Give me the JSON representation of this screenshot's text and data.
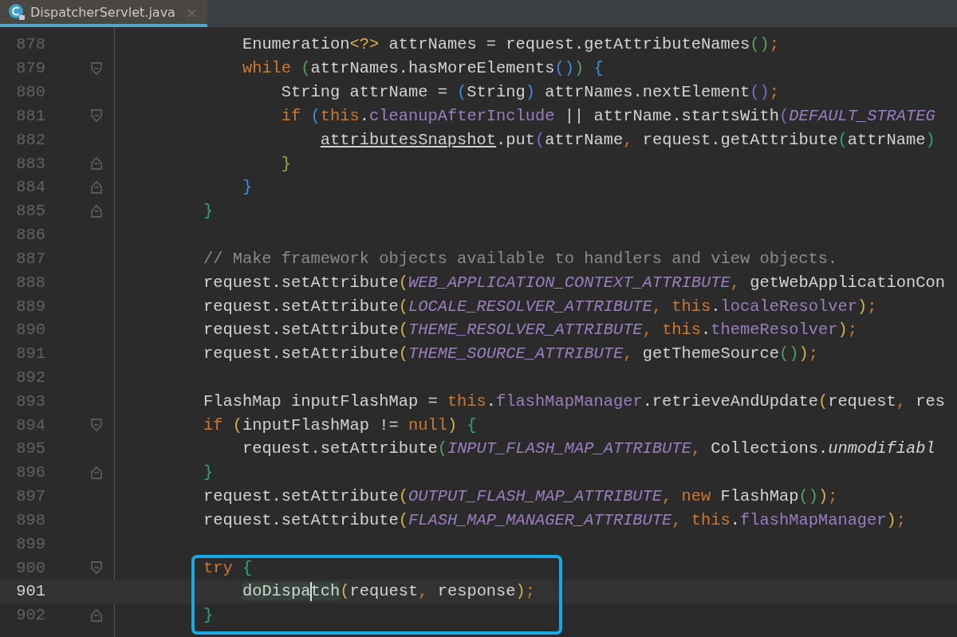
{
  "tabs": [
    {
      "label": "DispatcherServlet.java",
      "close": "×",
      "selected": true
    }
  ],
  "lines": [
    {
      "number": "878",
      "current": false,
      "boxed": false,
      "tokens": [
        {
          "kind": "plain",
          "t": "        Enumeration"
        },
        {
          "kind": "paren",
          "t": "<?>",
          "color": "#d8b449"
        },
        {
          "kind": "plain",
          "t": " attrNames = request.getAttributeNames"
        },
        {
          "kind": "paren",
          "t": "()",
          "color": "#4fa65a"
        },
        {
          "kind": "punct",
          "t": ";"
        }
      ]
    },
    {
      "number": "879",
      "current": false,
      "boxed": false,
      "fold_start": true,
      "fold_end": false,
      "tokens": [
        {
          "kind": "keyword",
          "t": "        while"
        },
        {
          "kind": "paren",
          "t": " (",
          "color": "#4fa65a"
        },
        {
          "kind": "plain",
          "t": "attrNames.hasMoreElements"
        },
        {
          "kind": "paren",
          "t": "()",
          "color": "#3f8fe0"
        },
        {
          "kind": "paren",
          "t": ")",
          "color": "#4fa65a"
        },
        {
          "kind": "paren",
          "t": " {",
          "color": "#3f8fe0"
        }
      ]
    },
    {
      "number": "880",
      "current": false,
      "boxed": false,
      "tokens": [
        {
          "kind": "plain",
          "t": "            String attrName = "
        },
        {
          "kind": "paren",
          "t": "(",
          "color": "#3f8fe0"
        },
        {
          "kind": "plain",
          "t": "String"
        },
        {
          "kind": "paren",
          "t": ")",
          "color": "#3f8fe0"
        },
        {
          "kind": "plain",
          "t": " attrNames.nextElement"
        },
        {
          "kind": "paren",
          "t": "()",
          "color": "#7f6ad0"
        },
        {
          "kind": "punct",
          "t": ";"
        }
      ]
    },
    {
      "number": "881",
      "current": false,
      "boxed": false,
      "fold_start": true,
      "fold_end": false,
      "tokens": [
        {
          "kind": "keyword",
          "t": "            if"
        },
        {
          "kind": "paren",
          "t": " (",
          "color": "#3f8fe0"
        },
        {
          "kind": "keyword",
          "t": "this"
        },
        {
          "kind": "plain",
          "t": "."
        },
        {
          "kind": "field",
          "t": "cleanupAfterInclude"
        },
        {
          "kind": "plain",
          "t": " || attrName.startsWith"
        },
        {
          "kind": "paren",
          "t": "(",
          "color": "#7f6ad0"
        },
        {
          "kind": "constant",
          "t": "DEFAULT_STRATEG"
        }
      ]
    },
    {
      "number": "882",
      "current": false,
      "boxed": false,
      "tokens": [
        {
          "kind": "underlined",
          "t": "                attributesSnapshot"
        },
        {
          "kind": "plain",
          "t": ".put"
        },
        {
          "kind": "paren",
          "t": "(",
          "color": "#7f6ad0"
        },
        {
          "kind": "plain",
          "t": "attrName"
        },
        {
          "kind": "punct",
          "t": ","
        },
        {
          "kind": "plain",
          "t": " request.getAttribute"
        },
        {
          "kind": "paren",
          "t": "(",
          "color": "#2fa38a"
        },
        {
          "kind": "plain",
          "t": "attrName"
        },
        {
          "kind": "paren",
          "t": ")",
          "color": "#2fa38a"
        }
      ]
    },
    {
      "number": "883",
      "current": false,
      "boxed": false,
      "fold_start": false,
      "fold_end": true,
      "tokens": [
        {
          "kind": "paren",
          "t": "            }",
          "color": "#8fb03a"
        }
      ]
    },
    {
      "number": "884",
      "current": false,
      "boxed": false,
      "fold_start": false,
      "fold_end": true,
      "tokens": [
        {
          "kind": "paren",
          "t": "        }",
          "color": "#3f8fe0"
        }
      ]
    },
    {
      "number": "885",
      "current": false,
      "boxed": false,
      "fold_start": false,
      "fold_end": true,
      "tokens": [
        {
          "kind": "paren",
          "t": "    }",
          "color": "#2fa38a"
        }
      ]
    },
    {
      "number": "886",
      "current": false,
      "boxed": false
    },
    {
      "number": "887",
      "current": false,
      "boxed": false,
      "tokens": [
        {
          "kind": "comment",
          "t": "    // Make framework objects available to handlers and view objects."
        }
      ]
    },
    {
      "number": "888",
      "current": false,
      "boxed": false,
      "tokens": [
        {
          "kind": "plain",
          "t": "    request.setAttribute"
        },
        {
          "kind": "paren",
          "t": "(",
          "color": "#d8b449"
        },
        {
          "kind": "constant",
          "t": "WEB_APPLICATION_CONTEXT_ATTRIBUTE"
        },
        {
          "kind": "punct",
          "t": ","
        },
        {
          "kind": "plain",
          "t": " getWebApplicationCon"
        }
      ]
    },
    {
      "number": "889",
      "current": false,
      "boxed": false,
      "tokens": [
        {
          "kind": "plain",
          "t": "    request.setAttribute"
        },
        {
          "kind": "paren",
          "t": "(",
          "color": "#d8b449"
        },
        {
          "kind": "constant",
          "t": "LOCALE_RESOLVER_ATTRIBUTE"
        },
        {
          "kind": "punct",
          "t": ","
        },
        {
          "kind": "keyword",
          "t": " this"
        },
        {
          "kind": "plain",
          "t": "."
        },
        {
          "kind": "field",
          "t": "localeResolver"
        },
        {
          "kind": "paren",
          "t": ")",
          "color": "#d8b449"
        },
        {
          "kind": "punct",
          "t": ";"
        }
      ]
    },
    {
      "number": "890",
      "current": false,
      "boxed": false,
      "tokens": [
        {
          "kind": "plain",
          "t": "    request.setAttribute"
        },
        {
          "kind": "paren",
          "t": "(",
          "color": "#d8b449"
        },
        {
          "kind": "constant",
          "t": "THEME_RESOLVER_ATTRIBUTE"
        },
        {
          "kind": "punct",
          "t": ","
        },
        {
          "kind": "keyword",
          "t": " this"
        },
        {
          "kind": "plain",
          "t": "."
        },
        {
          "kind": "field",
          "t": "themeResolver"
        },
        {
          "kind": "paren",
          "t": ")",
          "color": "#d8b449"
        },
        {
          "kind": "punct",
          "t": ";"
        }
      ]
    },
    {
      "number": "891",
      "current": false,
      "boxed": false,
      "tokens": [
        {
          "kind": "plain",
          "t": "    request.setAttribute"
        },
        {
          "kind": "paren",
          "t": "(",
          "color": "#d8b449"
        },
        {
          "kind": "constant",
          "t": "THEME_SOURCE_ATTRIBUTE"
        },
        {
          "kind": "punct",
          "t": ","
        },
        {
          "kind": "plain",
          "t": " getThemeSource"
        },
        {
          "kind": "paren",
          "t": "()",
          "color": "#4fa65a"
        },
        {
          "kind": "paren",
          "t": ")",
          "color": "#d8b449"
        },
        {
          "kind": "punct",
          "t": ";"
        }
      ]
    },
    {
      "number": "892",
      "current": false,
      "boxed": false
    },
    {
      "number": "893",
      "current": false,
      "boxed": false,
      "tokens": [
        {
          "kind": "plain",
          "t": "    FlashMap inputFlashMap = "
        },
        {
          "kind": "keyword",
          "t": "this"
        },
        {
          "kind": "plain",
          "t": "."
        },
        {
          "kind": "field",
          "t": "flashMapManager"
        },
        {
          "kind": "plain",
          "t": ".retrieveAndUpdate"
        },
        {
          "kind": "paren",
          "t": "(",
          "color": "#d8b449"
        },
        {
          "kind": "plain",
          "t": "request"
        },
        {
          "kind": "punct",
          "t": ","
        },
        {
          "kind": "plain",
          "t": " res"
        }
      ]
    },
    {
      "number": "894",
      "current": false,
      "boxed": false,
      "fold_start": true,
      "fold_end": false,
      "tokens": [
        {
          "kind": "keyword",
          "t": "    if"
        },
        {
          "kind": "paren",
          "t": " (",
          "color": "#d8b449"
        },
        {
          "kind": "plain",
          "t": "inputFlashMap != "
        },
        {
          "kind": "keyword",
          "t": "null"
        },
        {
          "kind": "paren",
          "t": ")",
          "color": "#d8b449"
        },
        {
          "kind": "paren",
          "t": " {",
          "color": "#2fa38a"
        }
      ]
    },
    {
      "number": "895",
      "current": false,
      "boxed": false,
      "tokens": [
        {
          "kind": "plain",
          "t": "        request.setAttribute"
        },
        {
          "kind": "paren",
          "t": "(",
          "color": "#4fa65a"
        },
        {
          "kind": "constant",
          "t": "INPUT_FLASH_MAP_ATTRIBUTE"
        },
        {
          "kind": "punct",
          "t": ","
        },
        {
          "kind": "plain",
          "t": " Collections."
        },
        {
          "kind": "static",
          "t": "unmodifiabl"
        }
      ]
    },
    {
      "number": "896",
      "current": false,
      "boxed": false,
      "fold_start": false,
      "fold_end": true,
      "tokens": [
        {
          "kind": "paren",
          "t": "    }",
          "color": "#2fa38a"
        }
      ]
    },
    {
      "number": "897",
      "current": false,
      "boxed": false,
      "tokens": [
        {
          "kind": "plain",
          "t": "    request.setAttribute"
        },
        {
          "kind": "paren",
          "t": "(",
          "color": "#d8b449"
        },
        {
          "kind": "constant",
          "t": "OUTPUT_FLASH_MAP_ATTRIBUTE"
        },
        {
          "kind": "punct",
          "t": ","
        },
        {
          "kind": "keyword",
          "t": " new"
        },
        {
          "kind": "plain",
          "t": " FlashMap"
        },
        {
          "kind": "paren",
          "t": "()",
          "color": "#4fa65a"
        },
        {
          "kind": "paren",
          "t": ")",
          "color": "#d8b449"
        },
        {
          "kind": "punct",
          "t": ";"
        }
      ]
    },
    {
      "number": "898",
      "current": false,
      "boxed": false,
      "tokens": [
        {
          "kind": "plain",
          "t": "    request.setAttribute"
        },
        {
          "kind": "paren",
          "t": "(",
          "color": "#d8b449"
        },
        {
          "kind": "constant",
          "t": "FLASH_MAP_MANAGER_ATTRIBUTE"
        },
        {
          "kind": "punct",
          "t": ","
        },
        {
          "kind": "keyword",
          "t": " this"
        },
        {
          "kind": "plain",
          "t": "."
        },
        {
          "kind": "field",
          "t": "flashMapManager"
        },
        {
          "kind": "paren",
          "t": ")",
          "color": "#d8b449"
        },
        {
          "kind": "punct",
          "t": ";"
        }
      ]
    },
    {
      "number": "899",
      "current": false,
      "boxed": false
    },
    {
      "number": "900",
      "current": false,
      "boxed": true,
      "fold_start": true,
      "fold_end": false,
      "tokens": [
        {
          "kind": "keyword",
          "t": "    try"
        },
        {
          "kind": "paren",
          "t": " {",
          "color": "#2fa38a"
        }
      ]
    },
    {
      "number": "901",
      "current": true,
      "boxed": true,
      "tokens": [
        {
          "kind": "usage",
          "t": "        doDispa",
          "caret": true
        },
        {
          "kind": "usage",
          "t": "tch"
        },
        {
          "kind": "paren",
          "t": "(",
          "color": "#d8b449"
        },
        {
          "kind": "plain",
          "t": "request"
        },
        {
          "kind": "punct",
          "t": ","
        },
        {
          "kind": "plain",
          "t": " response"
        },
        {
          "kind": "paren",
          "t": ")",
          "color": "#d8b449"
        },
        {
          "kind": "punct",
          "t": ";"
        }
      ]
    },
    {
      "number": "902",
      "current": false,
      "boxed": true,
      "fold_start": false,
      "fold_end": true,
      "tokens": [
        {
          "kind": "paren",
          "t": "    }",
          "color": "#2fa38a"
        }
      ]
    }
  ]
}
